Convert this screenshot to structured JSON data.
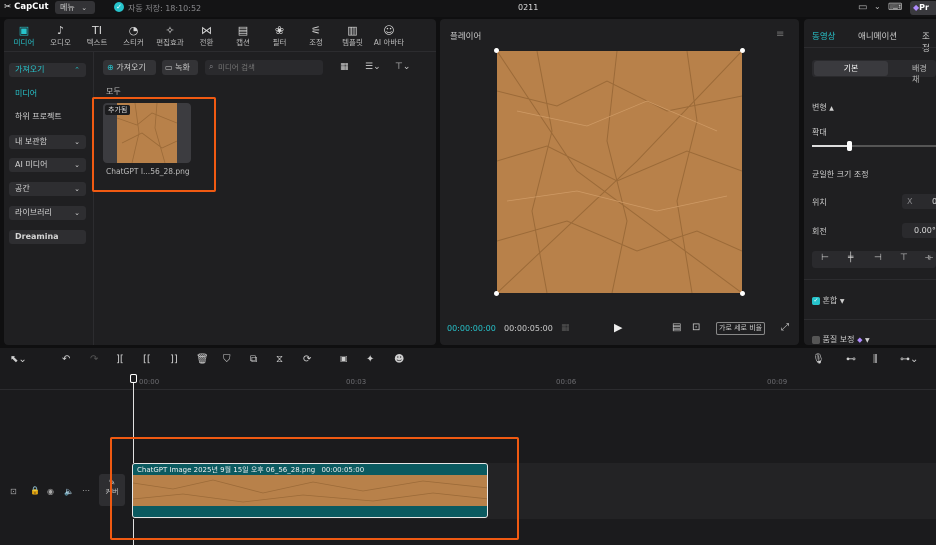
{
  "topbar": {
    "logo": "CapCut",
    "menu": "메뉴",
    "autosave": "자동 저장: 18:10:52",
    "project_name": "0211",
    "pro_label": "Pr"
  },
  "media_tabs": [
    {
      "label": "미디어",
      "icon": "▣"
    },
    {
      "label": "오디오",
      "icon": "♪"
    },
    {
      "label": "텍스트",
      "icon": "TI"
    },
    {
      "label": "스티커",
      "icon": "◔"
    },
    {
      "label": "편집효과",
      "icon": "✧"
    },
    {
      "label": "전환",
      "icon": "⋈"
    },
    {
      "label": "캡션",
      "icon": "▤"
    },
    {
      "label": "필터",
      "icon": "❀"
    },
    {
      "label": "조정",
      "icon": "⚟"
    },
    {
      "label": "템플릿",
      "icon": "▥"
    },
    {
      "label": "AI 아바타",
      "icon": "☺"
    }
  ],
  "left_nav": {
    "import": "가져오기",
    "media": "미디어",
    "subproject": "하위 프로젝트",
    "my_library": "내 보관함",
    "ai_media": "AI 미디어",
    "space": "공간",
    "library": "라이브러리",
    "dreamina": "Dreamina"
  },
  "media_toolbar": {
    "import_button": "가져오기",
    "record_button": "녹화",
    "search_placeholder": "미디어 검색"
  },
  "media": {
    "section_label": "모두",
    "added_badge": "추가됨",
    "file_name": "ChatGPT I...56_28.png"
  },
  "player": {
    "title": "플레이어",
    "time_current": "00:00:00:00",
    "time_total": "00:00:05:00",
    "ratio_button": "가로 세로 비율"
  },
  "inspector": {
    "tab_video": "동영상",
    "tab_animation": "애니메이션",
    "tab_adjust": "조정",
    "sub_basic": "기본",
    "sub_background": "배경 채",
    "transform": "변형",
    "scale": "확대",
    "scale_value": 0.3,
    "uniform_scale": "균일한 크기 조정",
    "position": "위치",
    "position_x": "X",
    "position_value": "0",
    "rotation": "회전",
    "rotation_value": "0.00°",
    "blend": "혼합",
    "quality": "품질 보정"
  },
  "ruler": {
    "t0": "00:00",
    "t3": "00:03",
    "t6": "00:06",
    "t9": "00:09"
  },
  "timeline": {
    "cover_label": "커버",
    "clip_name": "ChatGPT Image 2025년 9월 15일 오후 06_56_28.png",
    "clip_duration": "00:00:05:00"
  },
  "colors": {
    "accent": "#27c4cc",
    "highlight_box": "#f05a12",
    "clip_bg": "#0b5a60",
    "paper": "#b8814a"
  }
}
